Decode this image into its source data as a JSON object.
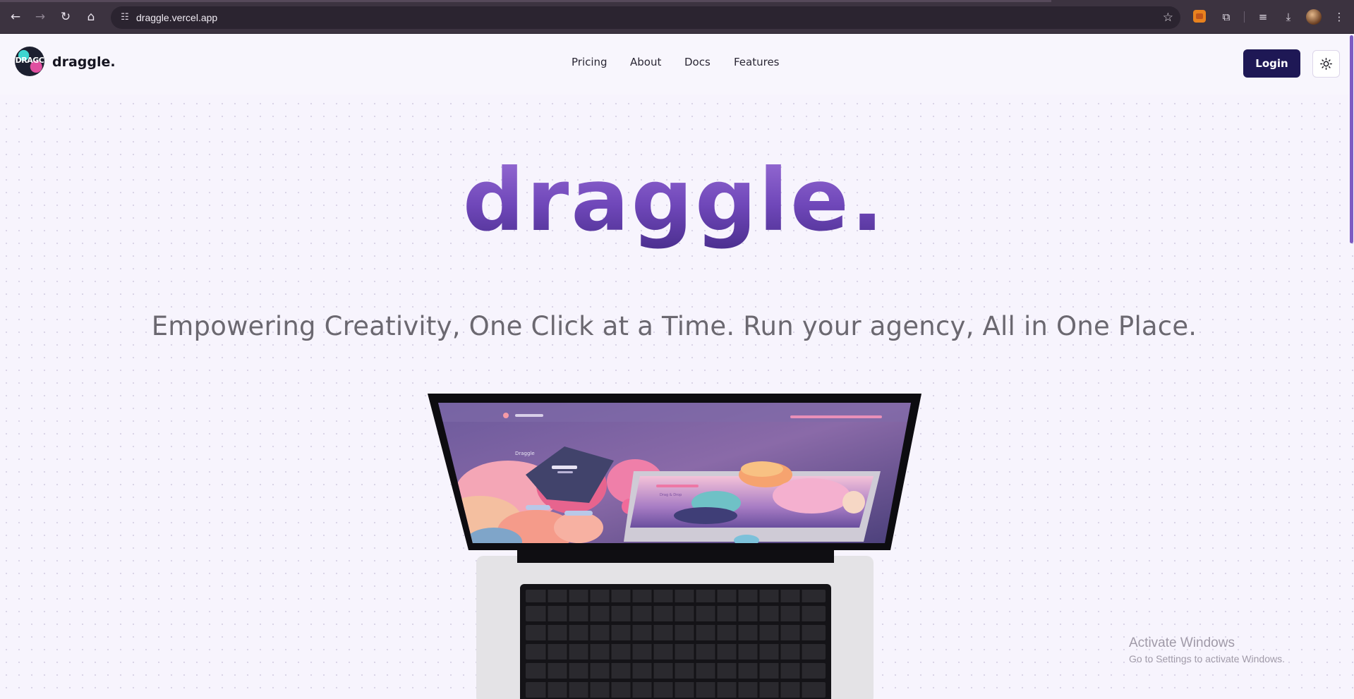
{
  "browser": {
    "url": "draggle.vercel.app",
    "nav": [
      {
        "name": "back-button",
        "icon": "arrow-left-icon",
        "glyph": "←"
      },
      {
        "name": "forward-button",
        "icon": "arrow-right-icon",
        "glyph": "→"
      },
      {
        "name": "reload-button",
        "icon": "reload-icon",
        "glyph": "↻"
      },
      {
        "name": "home-button",
        "icon": "home-icon",
        "glyph": "⌂"
      }
    ],
    "site_info_glyph": "☷",
    "star_glyph": "☆",
    "toolbar_glyphs": {
      "extensions": "⧉",
      "media": "≡",
      "downloads": "⤓",
      "menu": "⋮"
    }
  },
  "header": {
    "logo_text": "DRAGC",
    "brand": "draggle.",
    "nav": [
      {
        "label": "Pricing"
      },
      {
        "label": "About"
      },
      {
        "label": "Docs"
      },
      {
        "label": "Features"
      }
    ],
    "login_label": "Login",
    "theme_icon": "sun-icon"
  },
  "hero": {
    "title": "draggle.",
    "tagline": "Empowering Creativity, One Click at a Time. Run your agency, All in One Place."
  },
  "laptop_screen": {
    "app_name": "Draggle",
    "monitor_caption": "Drag & Drop"
  },
  "watermark": {
    "line1": "Activate Windows",
    "line2": "Go to Settings to activate Windows."
  },
  "colors": {
    "accent": "#6f47b9",
    "login_bg": "#1e1855",
    "page_bg": "#f7f4fd",
    "chrome_bg": "#3c3340"
  }
}
